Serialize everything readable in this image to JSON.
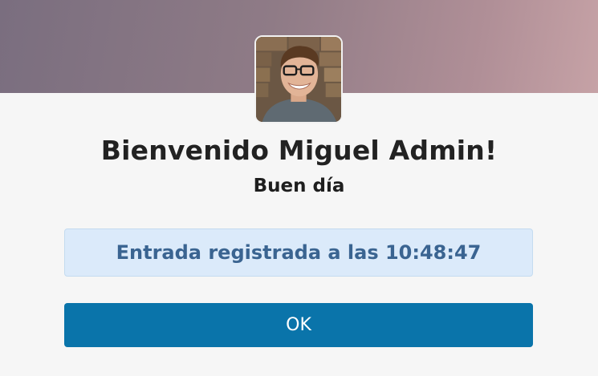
{
  "dialog": {
    "welcome_text": "Bienvenido Miguel Admin!",
    "greeting_text": "Buen día",
    "notice_text": "Entrada registrada a las 10:48:47",
    "ok_label": "OK"
  },
  "colors": {
    "header_gradient_start": "#7a6e7f",
    "header_gradient_end": "#c6a2a6",
    "background": "#f6f6f6",
    "notice_background": "#dbeafa",
    "notice_text": "#3a6491",
    "button_background": "#0a74aa",
    "button_text": "#ffffff"
  }
}
